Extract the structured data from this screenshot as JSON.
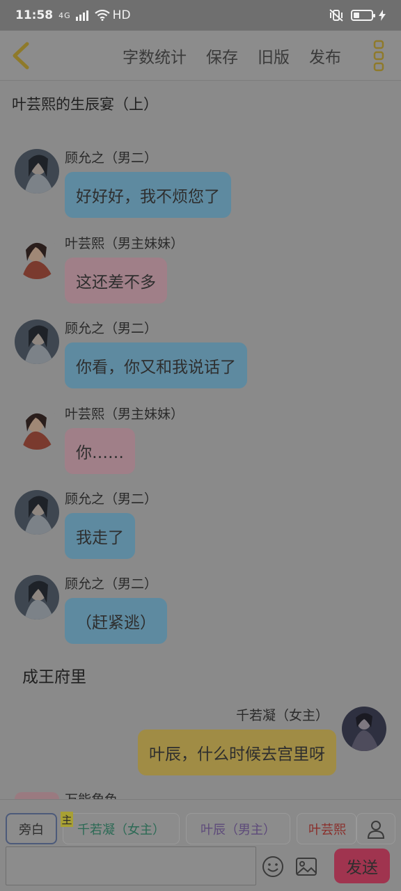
{
  "status": {
    "time": "11:58",
    "network": "4G",
    "hd": "HD"
  },
  "toolbar": {
    "actions": [
      "字数统计",
      "保存",
      "旧版",
      "发布"
    ]
  },
  "doc_title": "叶芸熙的生辰宴（上）",
  "messages": [
    {
      "name": "顾允之（男二）",
      "text": "好好好，我不烦您了"
    },
    {
      "name": "叶芸熙（男主妹妹）",
      "text": "这还差不多"
    },
    {
      "name": "顾允之（男二）",
      "text": "你看，你又和我说话了"
    },
    {
      "name": "叶芸熙（男主妹妹）",
      "text": "你……"
    },
    {
      "name": "顾允之（男二）",
      "text": "我走了"
    },
    {
      "name": "顾允之（男二）",
      "text": "（赶紧逃）"
    }
  ],
  "scene": "成王府里",
  "right_message": {
    "name": "千若凝（女主）",
    "text": "叶辰，什么时候去宫里呀"
  },
  "partial_name": "万能角色",
  "characters": {
    "narration": "旁白",
    "badge": "主",
    "items": [
      "千若凝（女主）",
      "叶辰（男主）",
      "叶芸熙"
    ]
  },
  "input": {
    "placeholder": "",
    "send": "发送"
  },
  "colors": {
    "blue_bubble": "#5e8aa0",
    "pink_bubble": "#a07f88",
    "gold_bubble": "#a08c45",
    "send": "#a0344f"
  }
}
